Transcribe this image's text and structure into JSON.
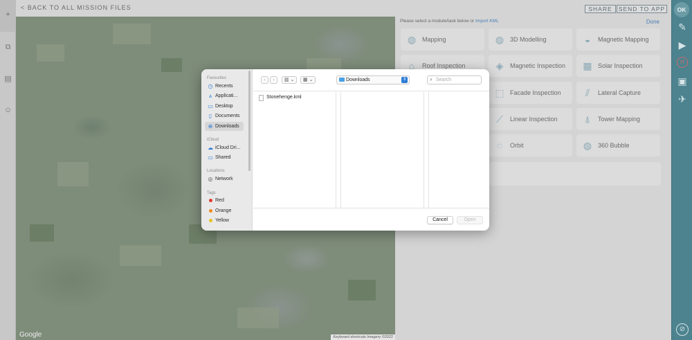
{
  "topbar": {
    "back_label": "< BACK TO ALL MISSION FILES",
    "share_label": "SHARE",
    "send_label": "SEND TO APP"
  },
  "map": {
    "google_label": "Google",
    "attribution": "Keyboard shortcuts    Imagery ©2022"
  },
  "panel": {
    "hint_prefix": "Please select a module/task below or ",
    "hint_link": "Import KML",
    "done_label": "Done",
    "tiles": [
      {
        "label": "Mapping",
        "icon": "grid-sphere-icon"
      },
      {
        "label": "3D Modelling",
        "icon": "globe-grid-icon"
      },
      {
        "label": "Magnetic Mapping",
        "icon": "magnet-grid-icon"
      },
      {
        "label": "Roof Inspection",
        "icon": "roof-icon"
      },
      {
        "label": "Magnetic Inspection",
        "icon": "magnet-icon"
      },
      {
        "label": "Solar Inspection",
        "icon": "solar-panel-icon"
      },
      {
        "label": "Facade Inspection",
        "icon": "facade-icon"
      },
      {
        "label": "Lateral Capture",
        "icon": "lateral-icon"
      },
      {
        "label": "Linear Inspection",
        "icon": "line-icon"
      },
      {
        "label": "Tower Mapping",
        "icon": "tower-icon"
      },
      {
        "label": "Orbit",
        "icon": "orbit-icon"
      },
      {
        "label": "360 Bubble",
        "icon": "bubble-icon"
      }
    ]
  },
  "right_rail": {
    "ok_label": "OK",
    "h_label": "H"
  },
  "dialog": {
    "sidebar": {
      "favourites_heading": "Favourites",
      "favourites": [
        {
          "label": "Recents",
          "icon": "clock-icon"
        },
        {
          "label": "Applicati...",
          "icon": "apps-icon"
        },
        {
          "label": "Desktop",
          "icon": "desktop-icon"
        },
        {
          "label": "Documents",
          "icon": "document-icon"
        },
        {
          "label": "Downloads",
          "icon": "download-icon"
        }
      ],
      "icloud_heading": "iCloud",
      "icloud": [
        {
          "label": "iCloud Dri...",
          "icon": "cloud-icon"
        },
        {
          "label": "Shared",
          "icon": "shared-folder-icon"
        }
      ],
      "locations_heading": "Locations",
      "locations": [
        {
          "label": "Network",
          "icon": "globe-icon"
        }
      ],
      "tags_heading": "Tags",
      "tags": [
        {
          "label": "Red",
          "color": "#e23a2f"
        },
        {
          "label": "Orange",
          "color": "#f08a1c"
        },
        {
          "label": "Yellow",
          "color": "#e8c21c"
        }
      ]
    },
    "location": "Downloads",
    "search_placeholder": "Search",
    "files": [
      "Stonehenge.kml"
    ],
    "cancel_label": "Cancel",
    "open_label": "Open"
  }
}
